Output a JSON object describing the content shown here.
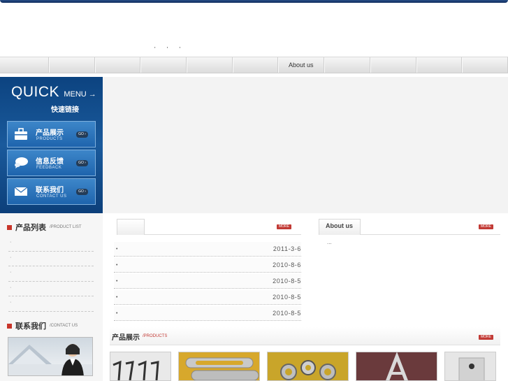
{
  "header": {
    "dots": [
      "'",
      "'",
      "'"
    ]
  },
  "nav": {
    "items": [
      "",
      "",
      "",
      "",
      "",
      "",
      "About us",
      "",
      "",
      "",
      ""
    ]
  },
  "quick_menu": {
    "title": "QUICK",
    "title_suffix": "MENU →",
    "subtitle": "快速链接",
    "buttons": [
      {
        "zh": "产品展示",
        "en": "PRODUCTS",
        "go": "GO ›"
      },
      {
        "zh": "信息反馈",
        "en": "FEEDBACK",
        "go": "GO ›"
      },
      {
        "zh": "联系我们",
        "en": "CONTACT US",
        "go": "GO ›"
      }
    ]
  },
  "product_list": {
    "title": "产品列表",
    "title_en": "/PRODUCT LIST",
    "items": [
      "·",
      "·",
      "·",
      "·",
      "·"
    ]
  },
  "contact": {
    "title": "联系我们",
    "title_en": "/CONTACT US"
  },
  "news": {
    "more_label": "MORE",
    "rows": [
      {
        "bullet": "•",
        "date": "2011-3-6"
      },
      {
        "bullet": "•",
        "date": "2010-8-6"
      },
      {
        "bullet": "•",
        "date": "2010-8-5"
      },
      {
        "bullet": "•",
        "date": "2010-8-5"
      },
      {
        "bullet": "•",
        "date": "2010-8-5"
      }
    ]
  },
  "about": {
    "title": "About us",
    "more_label": "MORE",
    "text": "..."
  },
  "products": {
    "title": "产品展示",
    "title_en": "/PRODUCTS",
    "more_label": "MORE"
  },
  "colors": {
    "brand_blue": "#1a5a9c",
    "accent_red": "#c23a35"
  }
}
